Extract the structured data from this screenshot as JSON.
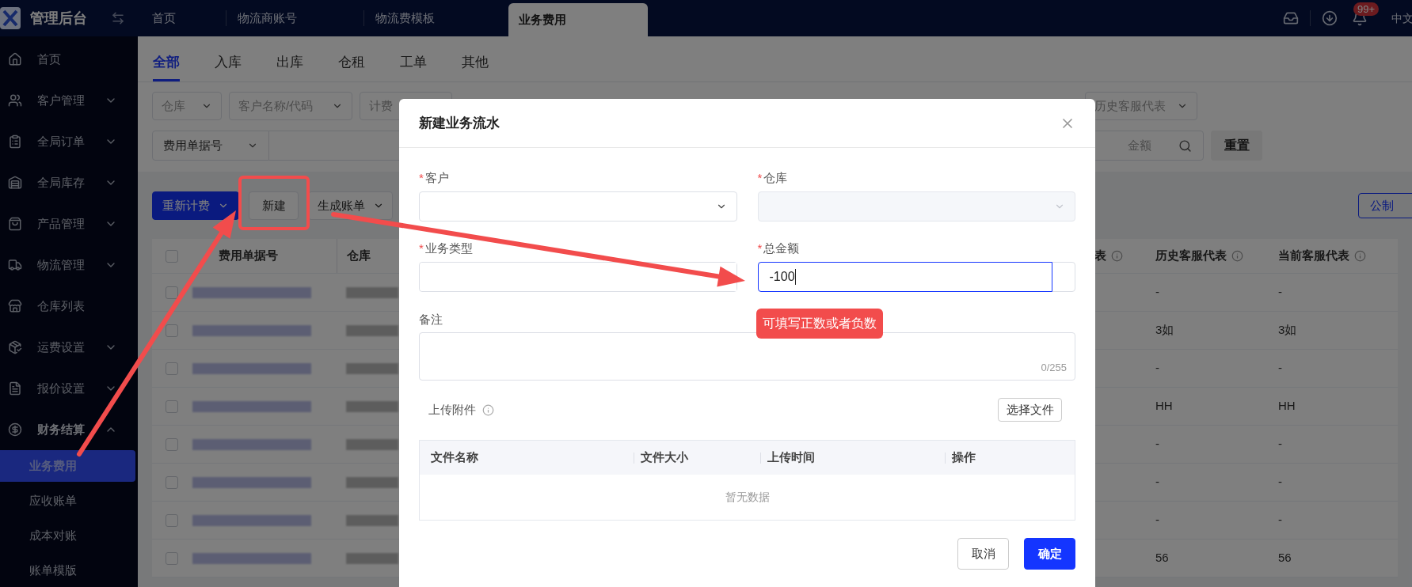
{
  "topbar": {
    "app_title": "管理后台",
    "tabs": [
      {
        "label": "首页",
        "selected": false
      },
      {
        "label": "物流商账号",
        "selected": false
      },
      {
        "label": "物流费模板",
        "selected": false
      },
      {
        "label": "业务费用",
        "selected": true
      }
    ],
    "notification_badge": "99+",
    "language": "中文"
  },
  "sidebar": {
    "items": [
      {
        "label": "首页",
        "kind": "link"
      },
      {
        "label": "客户管理",
        "kind": "group",
        "expanded": false
      },
      {
        "label": "全局订单",
        "kind": "group",
        "expanded": false
      },
      {
        "label": "全局库存",
        "kind": "group",
        "expanded": false
      },
      {
        "label": "产品管理",
        "kind": "group",
        "expanded": false
      },
      {
        "label": "物流管理",
        "kind": "group",
        "expanded": false
      },
      {
        "label": "仓库列表",
        "kind": "link"
      },
      {
        "label": "运费设置",
        "kind": "group",
        "expanded": false
      },
      {
        "label": "报价设置",
        "kind": "group",
        "expanded": false
      },
      {
        "label": "财务结算",
        "kind": "group",
        "expanded": true,
        "children": [
          {
            "label": "业务费用",
            "selected": true
          },
          {
            "label": "应收账单",
            "selected": false
          },
          {
            "label": "成本对账",
            "selected": false
          },
          {
            "label": "账单模版",
            "selected": false
          }
        ]
      }
    ]
  },
  "content_tabs": [
    {
      "label": "全部",
      "selected": true
    },
    {
      "label": "入库",
      "selected": false
    },
    {
      "label": "出库",
      "selected": false
    },
    {
      "label": "仓租",
      "selected": false
    },
    {
      "label": "工单",
      "selected": false
    },
    {
      "label": "其他",
      "selected": false
    }
  ],
  "filters": {
    "row_1": [
      {
        "placeholder": "仓库"
      },
      {
        "placeholder": "客户名称/代码"
      },
      {
        "placeholder": "计费"
      },
      {
        "placeholder": "历史客服代表"
      }
    ],
    "doc_type_select": "费用单据号",
    "amount_search": {
      "placeholder": "金额"
    },
    "reset_button": "重置"
  },
  "toolbar": {
    "buttons": [
      {
        "label": "重新计费",
        "kind": "primary"
      },
      {
        "label": "新建",
        "kind": "plain"
      },
      {
        "label": "生成账单",
        "kind": "menu"
      }
    ],
    "unit_button": "公制"
  },
  "table": {
    "select_all_checked": false,
    "columns": [
      {
        "label": "费用单据号",
        "info": false
      },
      {
        "label": "仓库",
        "info": false
      },
      {
        "label": "表",
        "info": true
      },
      {
        "label": "历史客服代表",
        "info": true
      },
      {
        "label": "当前客服代表",
        "info": true
      }
    ],
    "rows": [
      {
        "checked": false,
        "history_rep": "-",
        "current_rep": "-"
      },
      {
        "checked": false,
        "history_rep": "3如",
        "current_rep": "3如"
      },
      {
        "checked": false,
        "history_rep": "-",
        "current_rep": "-"
      },
      {
        "checked": false,
        "history_rep": "HH",
        "current_rep": "HH"
      },
      {
        "checked": false,
        "history_rep": "-",
        "current_rep": "-"
      },
      {
        "checked": false,
        "history_rep": "-",
        "current_rep": "-"
      },
      {
        "checked": false,
        "history_rep": "-",
        "current_rep": "-"
      },
      {
        "checked": false,
        "history_rep": "56",
        "current_rep": "56"
      }
    ]
  },
  "dialog": {
    "title": "新建业务流水",
    "fields": [
      {
        "label": "客户",
        "required": true,
        "required_mark": "*",
        "kind": "select",
        "disabled": false,
        "focused": false
      },
      {
        "label": "仓库",
        "required": true,
        "required_mark": "*",
        "kind": "select",
        "disabled": true,
        "focused": false
      },
      {
        "label": "业务类型",
        "required": true,
        "required_mark": "*",
        "kind": "input",
        "disabled": false,
        "focused": false
      },
      {
        "label": "总金额",
        "required": true,
        "required_mark": "*",
        "kind": "input",
        "disabled": false,
        "focused": true,
        "value": "-100"
      }
    ],
    "remark": {
      "label": "备注",
      "counter": "0/255"
    },
    "upload": {
      "label": "上传附件",
      "button": "选择文件"
    },
    "file_table": {
      "columns": [
        "文件名称",
        "文件大小",
        "上传时间",
        "操作"
      ],
      "empty_text": "暂无数据"
    },
    "buttons": [
      {
        "label": "取消",
        "kind": "plain"
      },
      {
        "label": "确定",
        "kind": "primary"
      }
    ]
  },
  "annotation": {
    "note": "可填写正数或者负数"
  }
}
